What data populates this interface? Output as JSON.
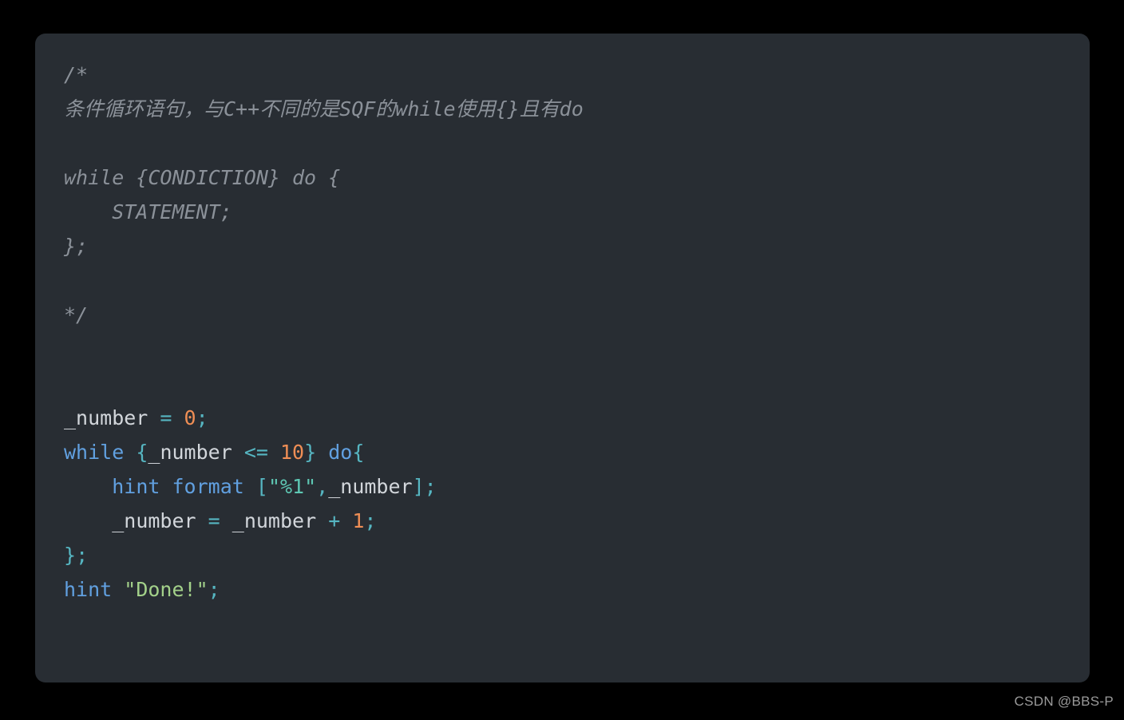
{
  "page": {
    "background_color": "#000000",
    "watermark": "CSDN @BBS-P"
  },
  "card": {
    "background_color": "#2b3036",
    "corner_radius_px": 13,
    "language": "SQF"
  },
  "palette": {
    "comment": "#8b9199",
    "keyword": "#61a0e0",
    "number": "#ef8e55",
    "operator": "#56b6c2",
    "punctuation": "#56b6c2",
    "variable": "#d2d6db",
    "string_format": "#5ec8b4",
    "string_plain": "#a3d18a"
  },
  "code": {
    "lines": [
      {
        "id": 1,
        "indent": 0,
        "type": "comment",
        "text": "/*"
      },
      {
        "id": 2,
        "indent": 0,
        "type": "comment",
        "text": "条件循环语句，与C++不同的是SQF的while使用{}且有do"
      },
      {
        "id": 3,
        "indent": 0,
        "type": "blank",
        "text": ""
      },
      {
        "id": 4,
        "indent": 0,
        "type": "comment",
        "text": "while {CONDICTION} do {"
      },
      {
        "id": 5,
        "indent": 1,
        "type": "comment",
        "text": "STATEMENT;"
      },
      {
        "id": 6,
        "indent": 0,
        "type": "comment",
        "text": "};"
      },
      {
        "id": 7,
        "indent": 0,
        "type": "blank",
        "text": ""
      },
      {
        "id": 8,
        "indent": 0,
        "type": "comment",
        "text": "*/"
      },
      {
        "id": 9,
        "indent": 0,
        "type": "blank",
        "text": ""
      },
      {
        "id": 10,
        "indent": 0,
        "type": "blank",
        "text": ""
      },
      {
        "id": 11,
        "indent": 0,
        "type": "code",
        "text": "_number = 0;"
      },
      {
        "id": 12,
        "indent": 0,
        "type": "code",
        "text": "while {_number <= 10} do{"
      },
      {
        "id": 13,
        "indent": 1,
        "type": "code",
        "text": "hint format [\"%1\",_number];"
      },
      {
        "id": 14,
        "indent": 1,
        "type": "code",
        "text": "_number = _number + 1;"
      },
      {
        "id": 15,
        "indent": 0,
        "type": "code",
        "text": "};"
      },
      {
        "id": 16,
        "indent": 0,
        "type": "code",
        "text": "hint \"Done!\";"
      }
    ],
    "tokens": {
      "l1_comment": "/*",
      "l2_comment": "条件循环语句，与C++不同的是SQF的while使用{}且有do",
      "l4_comment": "while {CONDICTION} do {",
      "l5_comment": "    STATEMENT;",
      "l6_comment": "};",
      "l8_comment": "*/",
      "l11_var": "_number",
      "l11_eq": "=",
      "l11_zero": "0",
      "l11_semi": ";",
      "l12_while": "while",
      "l12_brace_o": "{",
      "l12_var": "_number",
      "l12_lte": "<=",
      "l12_ten": "10",
      "l12_brace_c": "}",
      "l12_do": "do",
      "l12_brace_o2": "{",
      "l13_hint": "hint",
      "l13_format": "format",
      "l13_brk_o": "[",
      "l13_str": "\"%1\"",
      "l13_comma": ",",
      "l13_var": "_number",
      "l13_brk_c": "]",
      "l13_semi": ";",
      "l14_var_a": "_number",
      "l14_eq": "=",
      "l14_var_b": "_number",
      "l14_plus": "+",
      "l14_one": "1",
      "l14_semi": ";",
      "l15_brace_c": "}",
      "l15_semi": ";",
      "l16_hint": "hint",
      "l16_str": "\"Done!\"",
      "l16_semi": ";"
    }
  }
}
